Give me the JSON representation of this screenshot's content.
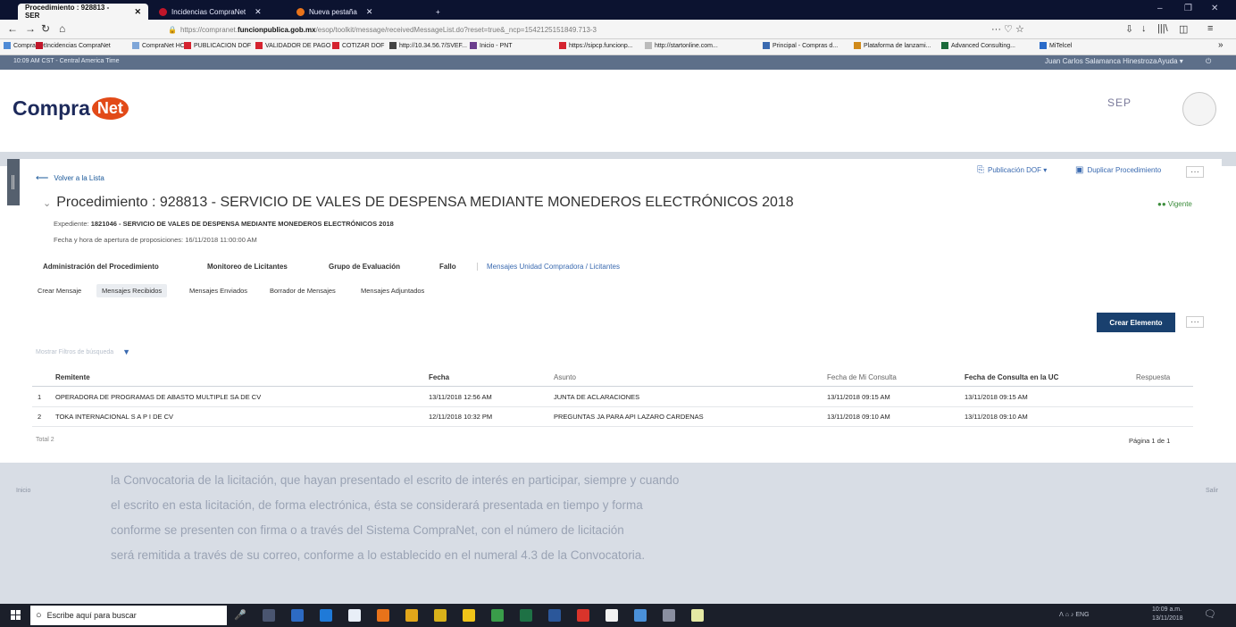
{
  "browser": {
    "tabs": [
      {
        "label": "Procedimiento : 928813 - SER",
        "close": "✕"
      },
      {
        "label": "Incidencias CompraNet",
        "close": "✕"
      },
      {
        "label": "Nueva pestaña",
        "close": "✕"
      }
    ],
    "new_tab": "+",
    "window_controls": [
      "–",
      "❐",
      "✕"
    ],
    "url_prefix": "https://compranet.",
    "url_host": "funcionpublica.gob.mx",
    "url_rest": "/esop/toolkit/message/receivedMessageList.do?reset=true&_ncp=1542125151849.713-3",
    "url_icons": "··· ♡ ☆",
    "right_tools": [
      "⇩",
      "↓",
      "|||\\",
      "◫",
      "≡"
    ],
    "bookmarks": [
      {
        "label": "CompraNet",
        "color": "#4f8bd6"
      },
      {
        "label": "Incidencias CompraNet",
        "color": "#c0162a"
      },
      {
        "label": "CompraNet HC",
        "color": "#7fa6d8"
      },
      {
        "label": "PUBLICACION DOF",
        "color": "#d5232f"
      },
      {
        "label": "VALIDADOR DE PAGO",
        "color": "#d5232f"
      },
      {
        "label": "COTIZAR DOF",
        "color": "#d5232f"
      },
      {
        "label": "http://10.34.56.7/SVEF...",
        "color": "#444444"
      },
      {
        "label": "Inicio - PNT",
        "color": "#6b3e8e"
      },
      {
        "label": "https://sipcp.funcionp...",
        "color": "#d5232f"
      },
      {
        "label": "http://startonline.com...",
        "color": "#bbbbbb"
      },
      {
        "label": "Principal - Compras d...",
        "color": "#3a6ab0"
      },
      {
        "label": "Plataforma de lanzami...",
        "color": "#d08a1a"
      },
      {
        "label": "Advanced Consulting...",
        "color": "#1a6a3a"
      },
      {
        "label": "MiTelcel",
        "color": "#2a6bc9"
      }
    ],
    "bookmarks_more": "»"
  },
  "appbar": {
    "time": "10:09 AM CST - Central America Time",
    "user": "Juan Carlos Salamanca Hinestroza",
    "help": "Ayuda ▾",
    "power": "⏻"
  },
  "logo": {
    "compra": "Compra",
    "net": "Net"
  },
  "sep_label": "SEP",
  "back_label": "Volver a la Lista",
  "top_actions": {
    "publicacion": "Publicación DOF ▾",
    "duplicar": "Duplicar Procedimiento",
    "more": "···"
  },
  "procedure": {
    "chevron": "⌄",
    "title": "Procedimiento : 928813 - SERVICIO DE VALES DE DESPENSA MEDIANTE MONEDEROS ELECTRÓNICOS 2018",
    "status": "●● Vigente",
    "expediente_label": "Expediente:",
    "expediente_value": "1821046 - SERVICIO DE VALES DE DESPENSA MEDIANTE MONEDEROS ELECTRÓNICOS 2018",
    "apertura_label": "Fecha y hora de apertura de proposiciones:",
    "apertura_value": "16/11/2018 11:00:00 AM"
  },
  "main_nav": [
    "Administración del Procedimiento",
    "Monitoreo de Licitantes",
    "Grupo de Evaluación",
    "Fallo",
    "Mensajes Unidad Compradora / Licitantes"
  ],
  "sub_nav": [
    "Crear Mensaje",
    "Mensajes Recibidos",
    "Mensajes Enviados",
    "Borrador de Mensajes",
    "Mensajes Adjuntados"
  ],
  "crear_label": "Crear Elemento",
  "crear_more": "···",
  "filter_placeholder": "Mostrar Filtros de búsqueda",
  "filter_caret": "▼",
  "table": {
    "headers": [
      "Remitente",
      "Fecha",
      "Asunto",
      "Fecha de Mi Consulta",
      "Fecha de Consulta en la UC",
      "Respuesta"
    ],
    "rows": [
      {
        "n": "1",
        "remitente": "OPERADORA DE PROGRAMAS DE ABASTO MULTIPLE SA DE CV",
        "fecha": "13/11/2018 12:56 AM",
        "asunto": "JUNTA DE ACLARACIONES",
        "mi_consulta": "13/11/2018 09:15 AM",
        "consulta_uc": "13/11/2018 09:15 AM",
        "respuesta": ""
      },
      {
        "n": "2",
        "remitente": "TOKA INTERNACIONAL S A P I DE CV",
        "fecha": "12/11/2018 10:32 PM",
        "asunto": "PREGUNTAS JA PARA API LAZARO CARDENAS",
        "mi_consulta": "13/11/2018 09:10 AM",
        "consulta_uc": "13/11/2018 09:10 AM",
        "respuesta": ""
      }
    ],
    "total": "Total 2",
    "pager": "Página 1 de 1"
  },
  "lower": {
    "lines": [
      "la Convocatoria de la licitación, que hayan presentado el escrito de interés en participar, siempre y cuando",
      "el escrito en esta licitación, de forma electrónica, ésta se considerará presentada en tiempo y forma",
      "conforme se presenten con firma o a través del Sistema CompraNet, con el número de licitación",
      "será remitida a través de su correo, conforme a lo establecido en el numeral 4.3 de la Convocatoria."
    ],
    "left_mark": "Inicio",
    "right_mark": "Salir"
  },
  "taskbar": {
    "search_placeholder": "Escribe aquí para buscar",
    "tray_time": "10:09 a.m.",
    "tray_date": "13/11/2018",
    "tray_icons": "ᐱ ⌂ ♪ ENG",
    "notif": "🗨"
  }
}
